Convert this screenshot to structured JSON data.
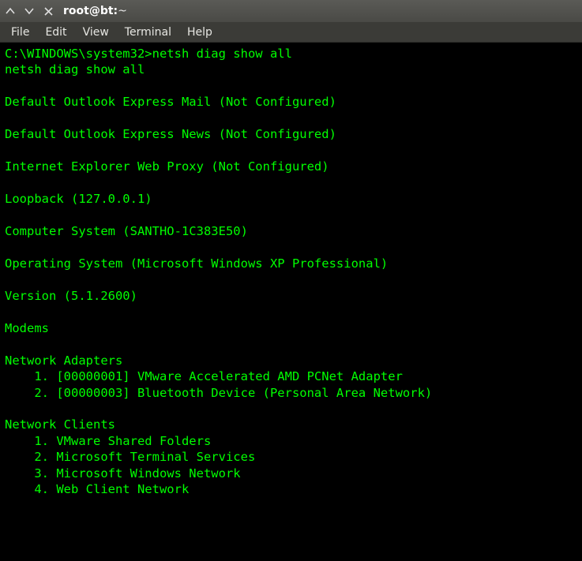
{
  "window": {
    "title_host": "root@bt: ",
    "title_path": "~"
  },
  "menu": {
    "file": "File",
    "edit": "Edit",
    "view": "View",
    "terminal": "Terminal",
    "help": "Help"
  },
  "terminal": {
    "prompt": "C:\\WINDOWS\\system32>",
    "command": "netsh diag show all",
    "echo": "netsh diag show all",
    "lines": {
      "mail": "Default Outlook Express Mail (Not Configured)",
      "news": "Default Outlook Express News (Not Configured)",
      "proxy": "Internet Explorer Web Proxy (Not Configured)",
      "loopback": "Loopback (127.0.0.1)",
      "computer": "Computer System (SANTHO-1C383E50)",
      "os": "Operating System (Microsoft Windows XP Professional)",
      "version": "Version (5.1.2600)",
      "modems": "Modems",
      "adapters_header": "Network Adapters",
      "adapter1": "    1. [00000001] VMware Accelerated AMD PCNet Adapter",
      "adapter2": "    2. [00000003] Bluetooth Device (Personal Area Network)",
      "clients_header": "Network Clients",
      "client1": "    1. VMware Shared Folders",
      "client2": "    2. Microsoft Terminal Services",
      "client3": "    3. Microsoft Windows Network",
      "client4": "    4. Web Client Network"
    }
  }
}
